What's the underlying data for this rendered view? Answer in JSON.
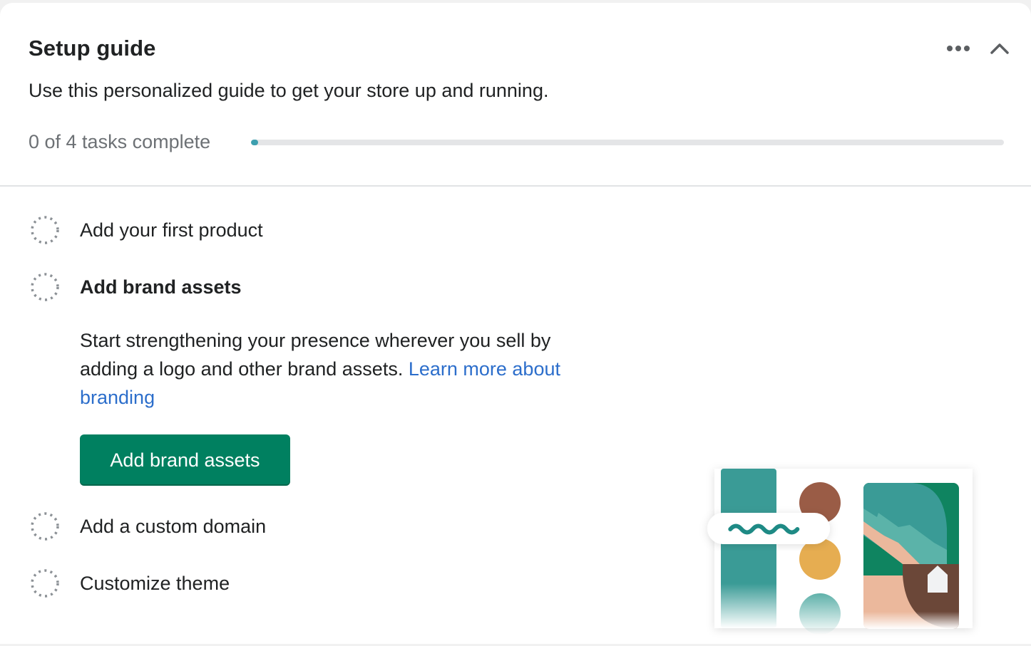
{
  "card": {
    "title": "Setup guide",
    "subtitle": "Use this personalized guide to get your store up and running.",
    "actions": {
      "more_icon": "more-horizontal-icon",
      "collapse_icon": "chevron-up-icon"
    }
  },
  "progress": {
    "label": "0 of 4 tasks complete",
    "completed": 0,
    "total": 4,
    "fill_color": "#3d9faf"
  },
  "tasks": [
    {
      "label": "Add your first product",
      "status": "incomplete",
      "expanded": false
    },
    {
      "label": "Add brand assets",
      "status": "incomplete",
      "expanded": true,
      "description": "Start strengthening your presence wherever you sell by adding a logo and other brand assets. ",
      "link_text": "Learn more about branding",
      "button_label": "Add brand assets",
      "illustration": "brand-assets-illustration"
    },
    {
      "label": "Add a custom domain",
      "status": "incomplete",
      "expanded": false
    },
    {
      "label": "Customize theme",
      "status": "incomplete",
      "expanded": false
    }
  ],
  "colors": {
    "primary_button": "#008060",
    "link": "#2c6ecb",
    "text": "#202223",
    "subdued_text": "#6d7175"
  }
}
